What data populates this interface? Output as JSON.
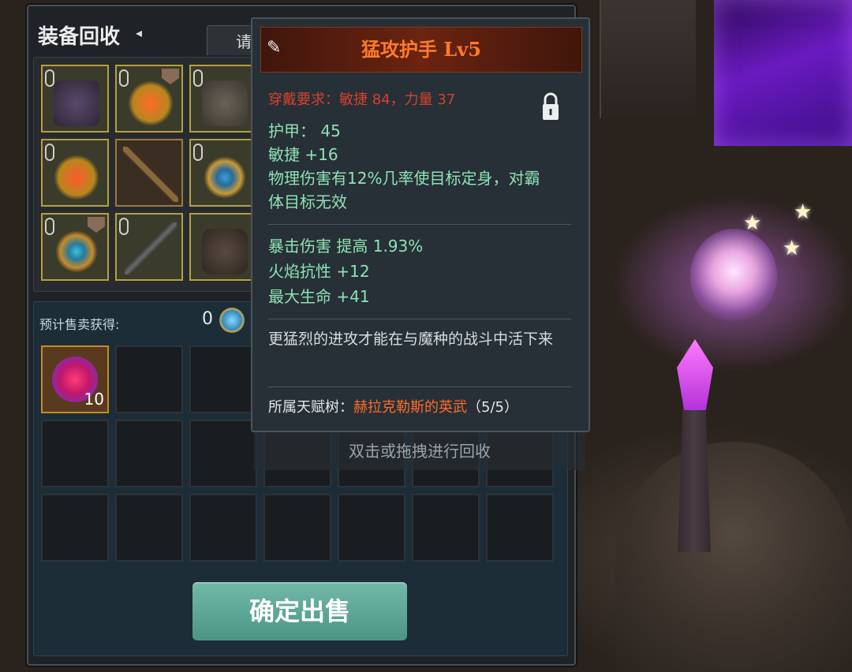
{
  "panel": {
    "title": "装备回收",
    "back_icon": "arrow-left-icon",
    "tab_label": "请"
  },
  "equipment_slots": [
    {
      "name": "armor-item",
      "bound": true
    },
    {
      "name": "amulet-item",
      "bound": true,
      "rank_badge": true
    },
    {
      "name": "gauntlet-item",
      "bound": true
    },
    {
      "name": "necklace-item",
      "bound": true
    },
    {
      "name": "bow-item",
      "bound": false
    },
    {
      "name": "ring-item",
      "bound": true
    },
    {
      "name": "ring-item",
      "bound": true,
      "rank_badge": true
    },
    {
      "name": "sword-item",
      "bound": true
    },
    {
      "name": "helmet-item",
      "bound": false
    }
  ],
  "sale": {
    "label": "预计售卖获得:",
    "value": "0",
    "currency_icon": "coin-icon",
    "first_item_count": "10"
  },
  "hint": "双击或拖拽进行回收",
  "confirm_button": "确定出售",
  "tooltip": {
    "title": "猛攻护手 Lv5",
    "requirement": "穿戴要求：敏捷 84，力量 37",
    "lock_icon": "lock-icon",
    "base_stats": [
      "护甲： 45",
      "敏捷 +16",
      "物理伤害有12%几率使目标定身，对霸",
      "体目标无效"
    ],
    "bonus_stats": [
      "暴击伤害 提高 1.93%",
      "火焰抗性 +12",
      "最大生命 +41"
    ],
    "flavor": "更猛烈的进攻才能在与魔种的战斗中活下来",
    "talent_label": "所属天赋树：",
    "talent_name": "赫拉克勒斯的英武",
    "talent_progress": "（5/5）"
  },
  "colors": {
    "title_orange": "#ff7a2a",
    "requirement_red": "#d8402e",
    "stat_green": "#8ee2b4",
    "button_teal": "#5aa898"
  }
}
